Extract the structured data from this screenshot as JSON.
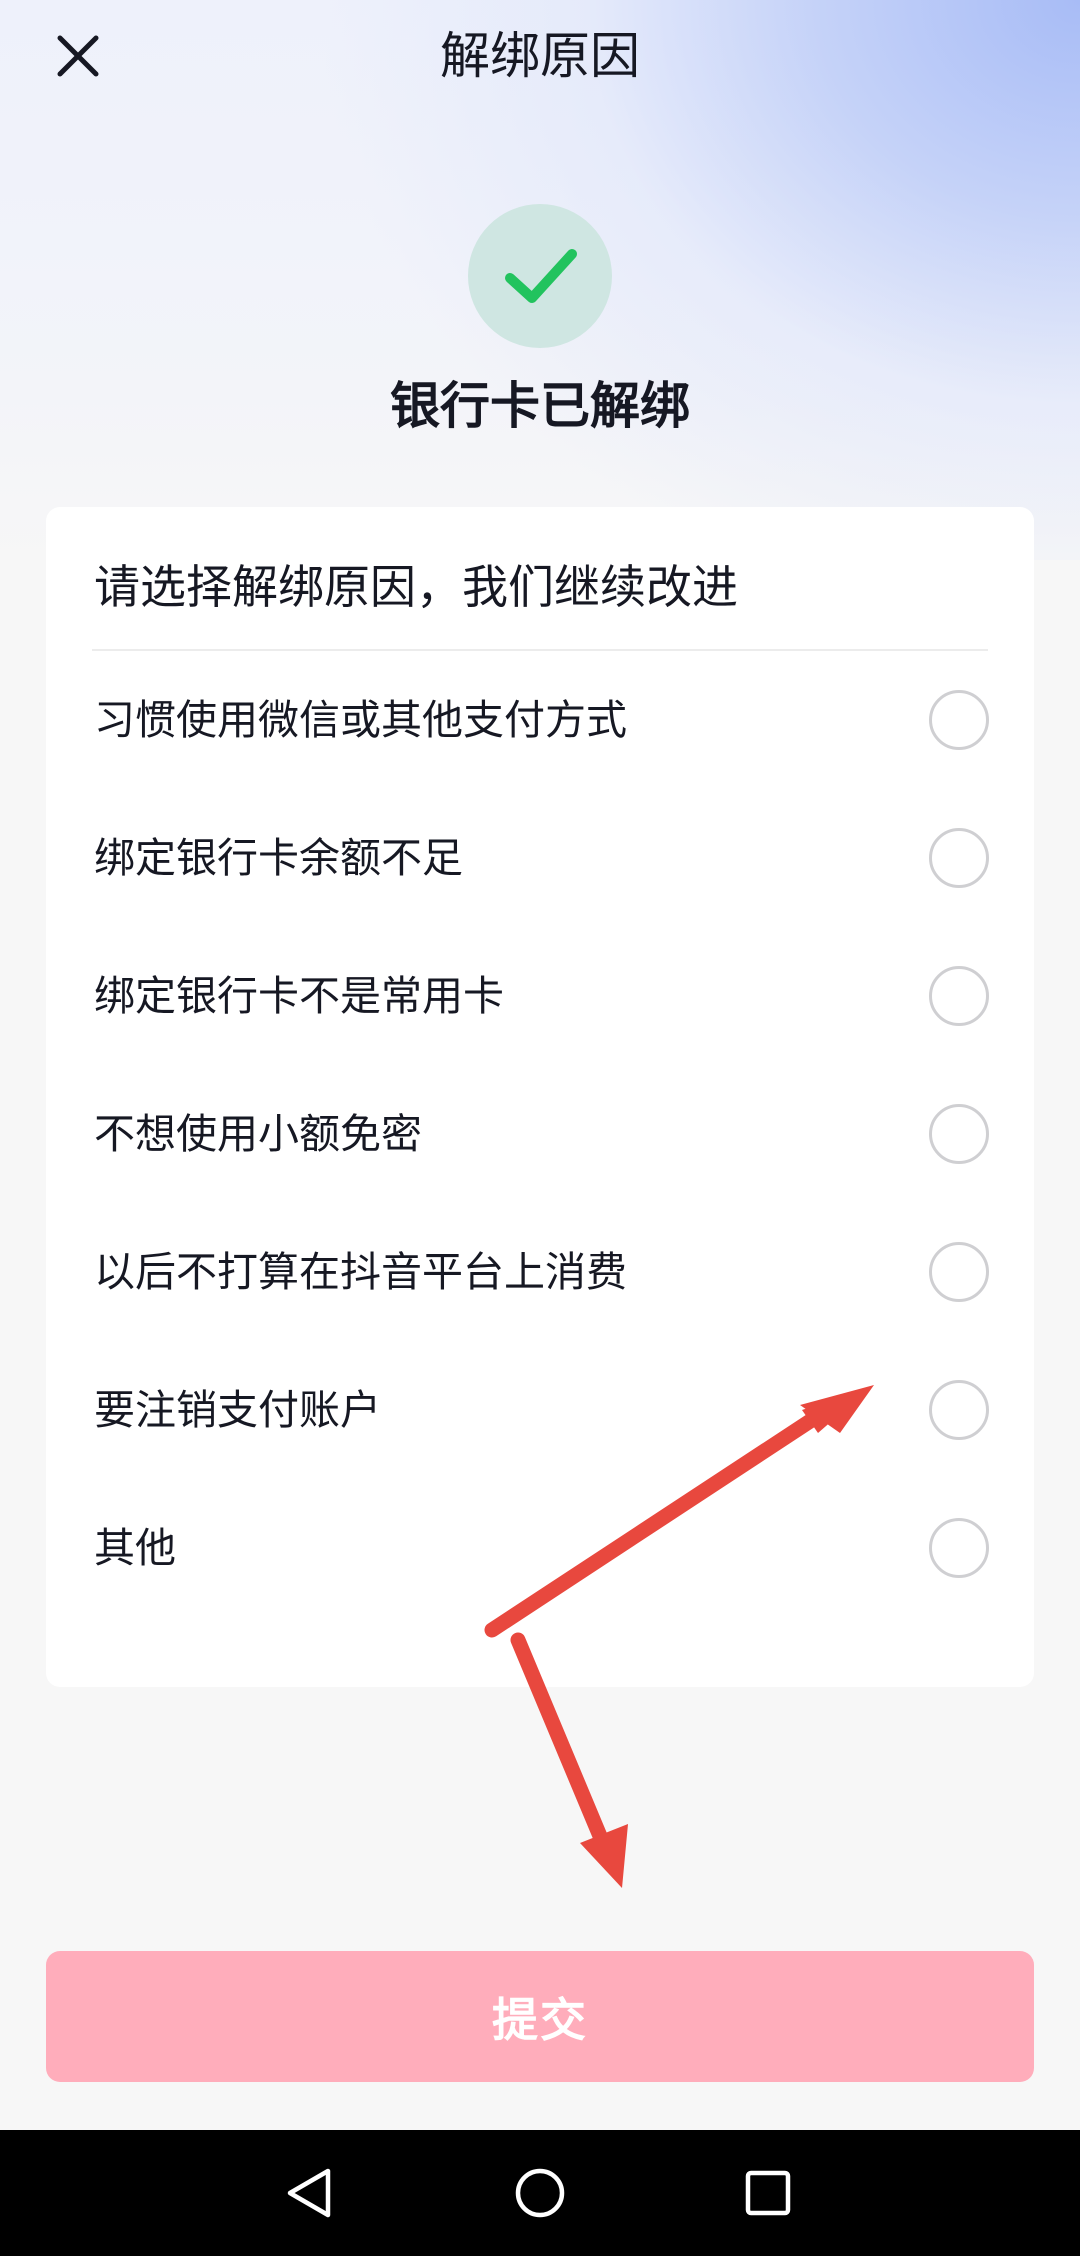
{
  "header": {
    "title": "解绑原因",
    "close_icon": "close-icon"
  },
  "status": {
    "icon": "checkmark-icon",
    "text": "银行卡已解绑",
    "icon_color": "#22c35e"
  },
  "card": {
    "title": "请选择解绑原因，我们继续改进",
    "options": [
      {
        "label": "习惯使用微信或其他支付方式",
        "selected": false
      },
      {
        "label": "绑定银行卡余额不足",
        "selected": false
      },
      {
        "label": "绑定银行卡不是常用卡",
        "selected": false
      },
      {
        "label": "不想使用小额免密",
        "selected": false
      },
      {
        "label": "以后不打算在抖音平台上消费",
        "selected": false
      },
      {
        "label": "要注销支付账户",
        "selected": false
      },
      {
        "label": "其他",
        "selected": false
      }
    ]
  },
  "submit": {
    "label": "提交",
    "color": "#ffadbb"
  },
  "navigation": {
    "back_icon": "back-triangle-icon",
    "home_icon": "home-circle-icon",
    "recents_icon": "recents-square-icon"
  },
  "annotation": {
    "arrow_color": "#e8483e"
  }
}
